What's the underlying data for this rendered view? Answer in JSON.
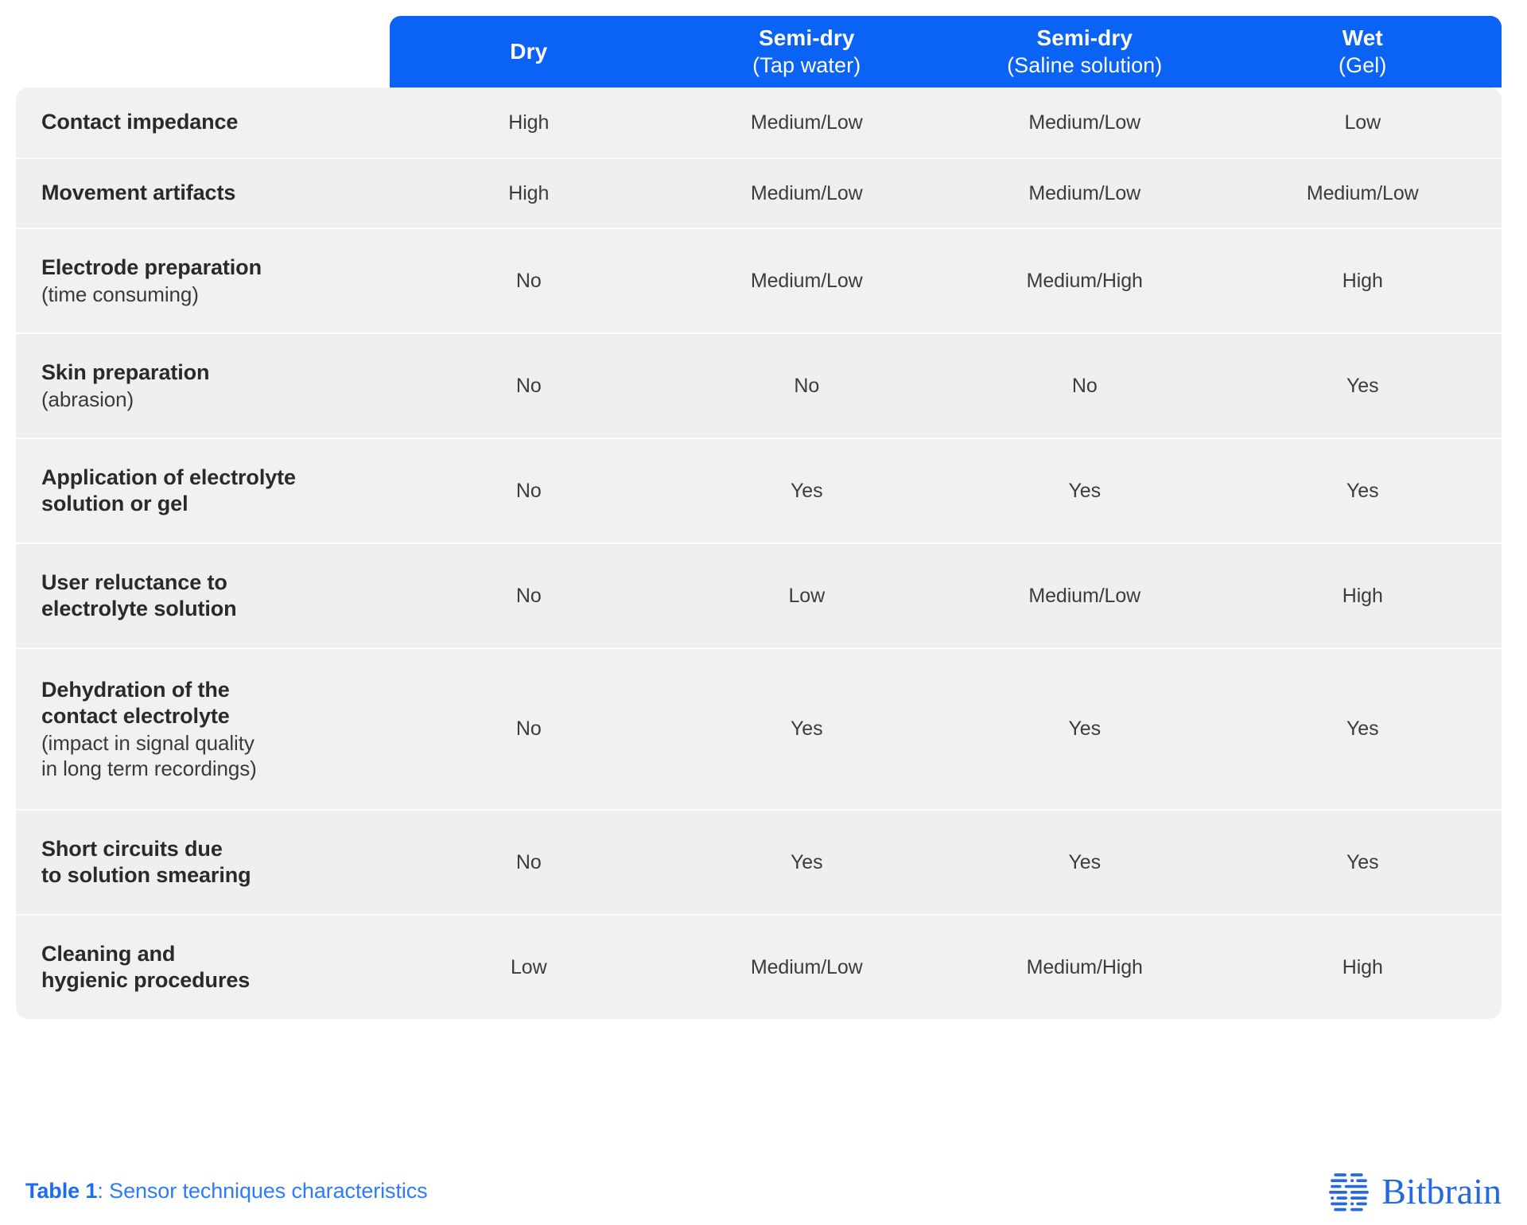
{
  "colors": {
    "header_blue": "#0B63F6",
    "row_bg": "#F1F1F2",
    "row_bg_alt": "#EFEFF0",
    "divider": "#FBFBFB",
    "caption_blue": "#2E7BF6",
    "brand_blue": "#2568E0",
    "label_text": "#2A2A2A",
    "cell_text": "#3C3C3C"
  },
  "table": {
    "columns": [
      {
        "main": "Dry",
        "sub": ""
      },
      {
        "main": "Semi-dry",
        "sub": "(Tap water)"
      },
      {
        "main": "Semi-dry",
        "sub": "(Saline solution)"
      },
      {
        "main": "Wet",
        "sub": "(Gel)"
      }
    ],
    "rows": [
      {
        "label": "Contact impedance",
        "sublabel": "",
        "values": [
          "High",
          "Medium/Low",
          "Medium/Low",
          "Low"
        ]
      },
      {
        "label": "Movement artifacts",
        "sublabel": "",
        "values": [
          "High",
          "Medium/Low",
          "Medium/Low",
          "Medium/Low"
        ]
      },
      {
        "label": "Electrode preparation",
        "sublabel": "(time consuming)",
        "values": [
          "No",
          "Medium/Low",
          "Medium/High",
          "High"
        ]
      },
      {
        "label": "Skin preparation",
        "sublabel": "(abrasion)",
        "values": [
          "No",
          "No",
          "No",
          "Yes"
        ]
      },
      {
        "label": "Application of electrolyte\nsolution or gel",
        "sublabel": "",
        "values": [
          "No",
          "Yes",
          "Yes",
          "Yes"
        ]
      },
      {
        "label": "User reluctance to\nelectrolyte solution",
        "sublabel": "",
        "values": [
          "No",
          "Low",
          "Medium/Low",
          "High"
        ]
      },
      {
        "label": "Dehydration of the\ncontact electrolyte",
        "sublabel": "(impact in signal quality\nin long term recordings)",
        "values": [
          "No",
          "Yes",
          "Yes",
          "Yes"
        ]
      },
      {
        "label": "Short circuits due\nto solution smearing",
        "sublabel": "",
        "values": [
          "No",
          "Yes",
          "Yes",
          "Yes"
        ]
      },
      {
        "label": "Cleaning and\nhygienic procedures",
        "sublabel": "",
        "values": [
          "Low",
          "Medium/Low",
          "Medium/High",
          "High"
        ]
      }
    ]
  },
  "footer": {
    "caption_label": "Table 1",
    "caption_separator": ": ",
    "caption_text": "Sensor techniques characteristics",
    "brand_name": "Bitbrain",
    "brand_mark_icon": "bitbrain-dashes-logo-icon"
  }
}
